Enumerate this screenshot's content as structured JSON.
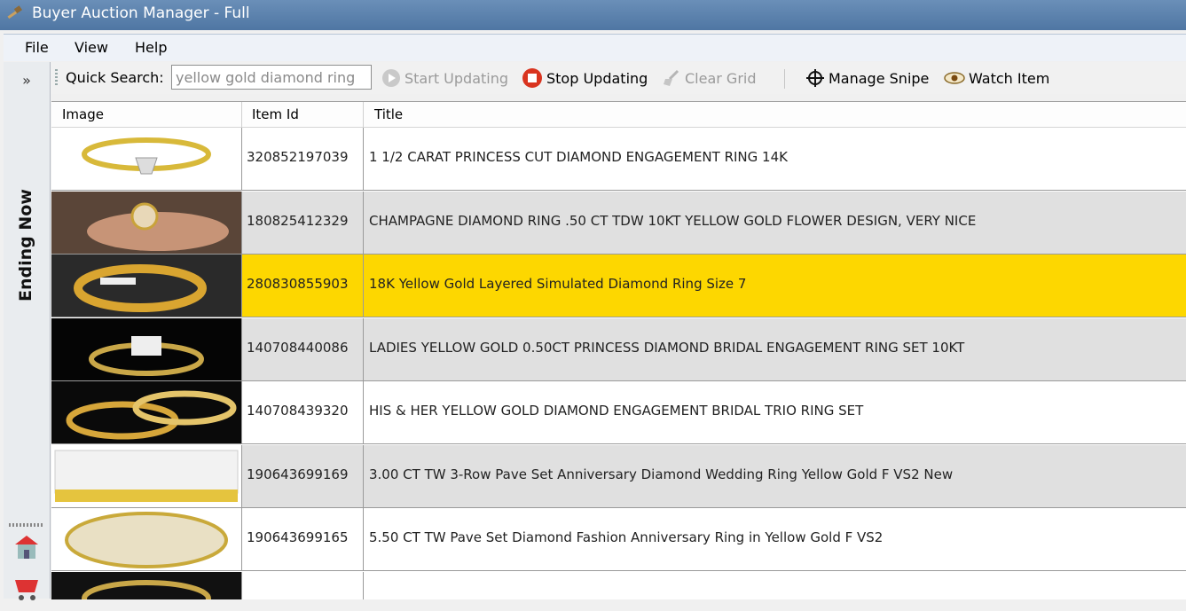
{
  "window": {
    "title": "Buyer Auction Manager - Full",
    "app_icon": "gavel-icon"
  },
  "menu": {
    "items": [
      "File",
      "View",
      "Help"
    ]
  },
  "toolbar": {
    "quick_search_label": "Quick Search:",
    "search_value": "yellow gold diamond ring",
    "start_updating": "Start Updating",
    "stop_updating": "Stop Updating",
    "clear_grid": "Clear Grid",
    "manage_snipe": "Manage Snipe",
    "watch_item": "Watch Item"
  },
  "left_panel": {
    "expand_label": "»",
    "ending_now": "Ending Now"
  },
  "grid": {
    "columns": [
      "Image",
      "Item Id",
      "Title"
    ],
    "rows": [
      {
        "item_id": "320852197039",
        "title": "1 1/2 CARAT PRINCESS CUT DIAMOND ENGAGEMENT RING 14K",
        "style": "white",
        "thumb": "ring-thumbnail"
      },
      {
        "item_id": "180825412329",
        "title": "CHAMPAGNE DIAMOND RING .50 CT TDW 10KT YELLOW GOLD FLOWER DESIGN, VERY NICE",
        "style": "alt",
        "thumb": "ring-thumbnail"
      },
      {
        "item_id": "280830855903",
        "title": "18K Yellow Gold Layered Simulated Diamond Ring Size 7",
        "style": "sel",
        "thumb": "ring-thumbnail"
      },
      {
        "item_id": "140708440086",
        "title": "LADIES YELLOW GOLD 0.50CT PRINCESS DIAMOND BRIDAL ENGAGEMENT RING SET 10KT",
        "style": "alt",
        "thumb": "ring-thumbnail"
      },
      {
        "item_id": "140708439320",
        "title": "HIS & HER YELLOW GOLD DIAMOND ENGAGEMENT BRIDAL TRIO RING SET",
        "style": "white",
        "thumb": "ring-thumbnail"
      },
      {
        "item_id": "190643699169",
        "title": "3.00 CT TW 3-Row Pave Set Anniversary Diamond Wedding Ring Yellow Gold F VS2 New",
        "style": "alt",
        "thumb": "ring-thumbnail"
      },
      {
        "item_id": "190643699165",
        "title": "5.50 CT TW Pave Set Diamond Fashion Anniversary Ring in Yellow Gold F VS2",
        "style": "white",
        "thumb": "ring-thumbnail"
      }
    ]
  },
  "colors": {
    "selected_row": "#fdd700",
    "alt_row": "#e0e0e0",
    "titlebar": "#5a80ad"
  }
}
